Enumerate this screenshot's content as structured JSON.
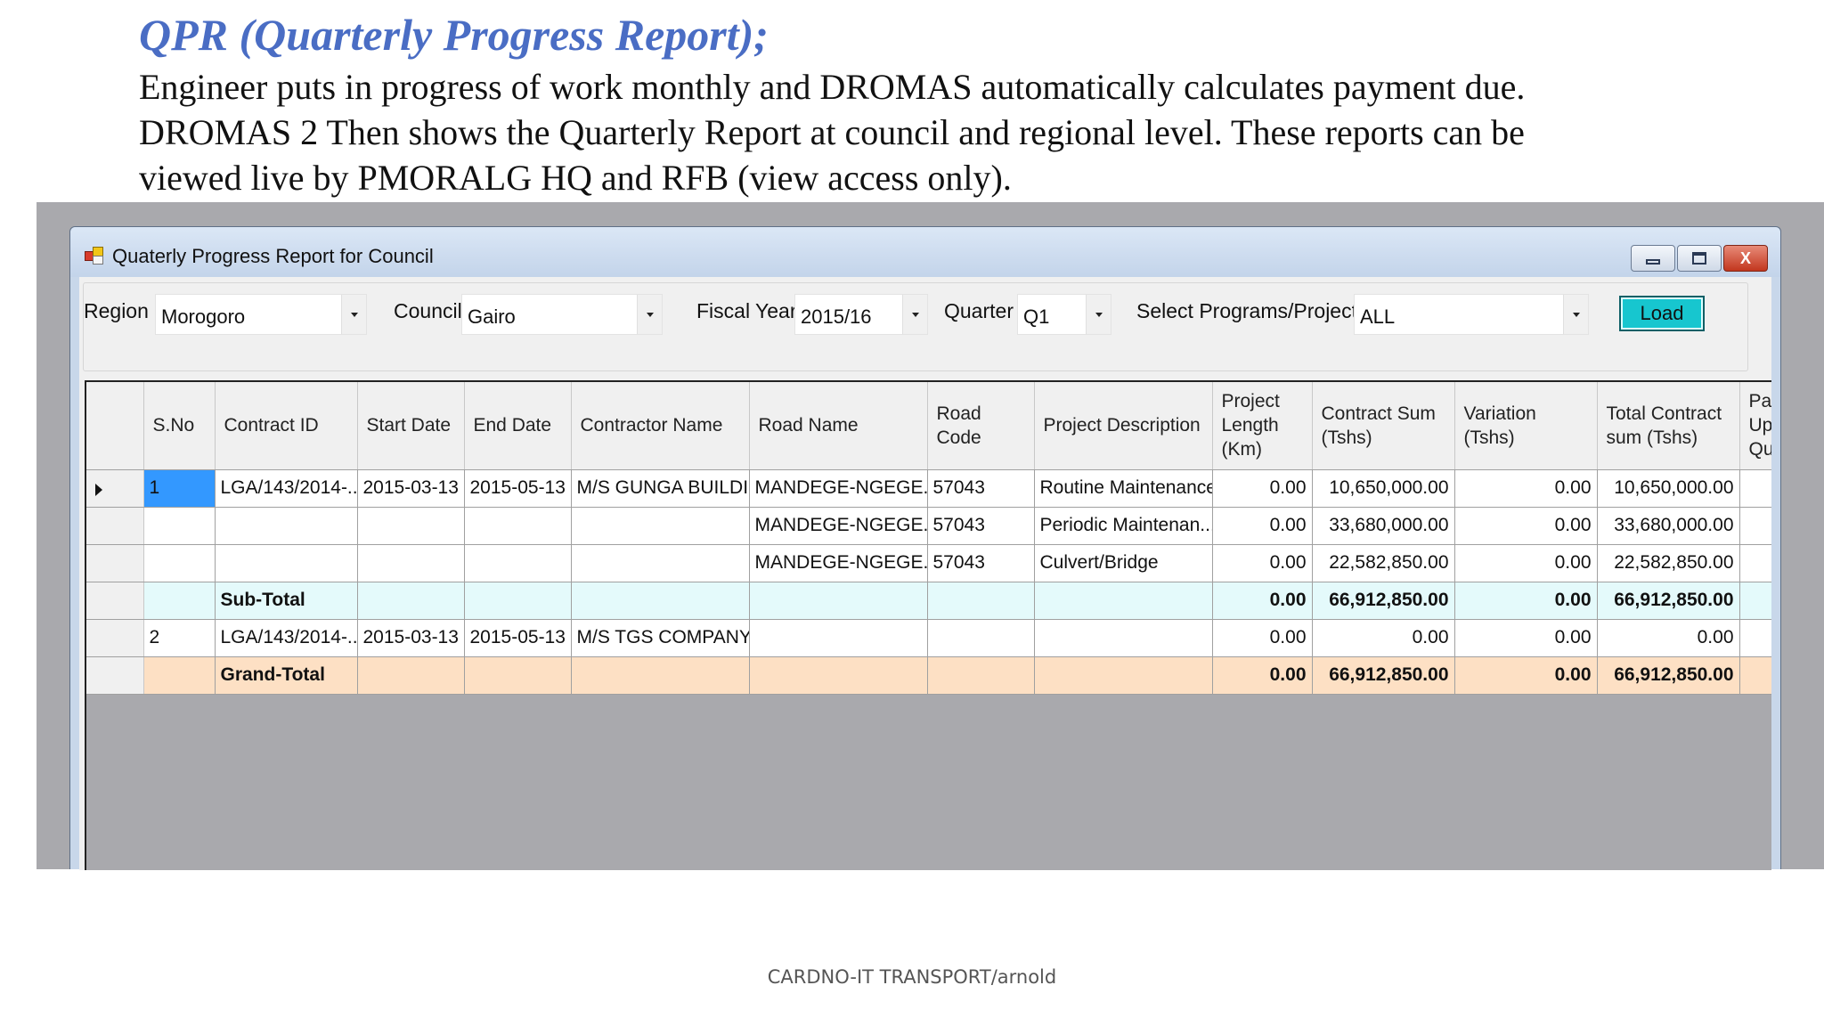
{
  "slide": {
    "title": "QPR (Quarterly Progress Report);",
    "body_lines": [
      "Engineer puts in progress of work monthly and DROMAS automatically calculates payment due.",
      "DROMAS 2 Then shows the Quarterly Report at council and regional level. These reports can be",
      "viewed live by PMORALG HQ and RFB  (view access only)."
    ],
    "footer": "CARDNO-IT TRANSPORT/arnold"
  },
  "window": {
    "title": "Quaterly Progress Report for Council",
    "buttons": {
      "minimize": "minimize",
      "maximize": "maximize",
      "close": "X"
    }
  },
  "filters": {
    "region_label": "Region",
    "region_value": "Morogoro",
    "council_label": "Council",
    "council_value": "Gairo",
    "fiscal_year_label": "Fiscal Year",
    "fiscal_year_value": "2015/16",
    "quarter_label": "Quarter",
    "quarter_value": "Q1",
    "programs_label": "Select Programs/Projects:",
    "programs_value": "ALL",
    "load_label": "Load"
  },
  "grid": {
    "columns": [
      "S.No",
      "Contract ID",
      "Start Date",
      "End Date",
      "Contractor Name",
      "Road Name",
      "Road Code",
      "Project Description",
      "Project Length (Km)",
      "Contract Sum (Tshs)",
      "Variation (Tshs)",
      "Total Contract sum (Tshs)",
      "Pa Up Qu"
    ],
    "rows": [
      {
        "type": "data",
        "current": true,
        "cells": [
          "1",
          "LGA/143/2014-...",
          "2015-03-13",
          "2015-05-13",
          "M/S GUNGA BUILDI...",
          "MANDEGE-NGEGE...",
          "57043",
          "Routine Maintenance",
          "0.00",
          "10,650,000.00",
          "0.00",
          "10,650,000.00",
          ""
        ]
      },
      {
        "type": "data",
        "current": false,
        "cells": [
          "",
          "",
          "",
          "",
          "",
          "MANDEGE-NGEGE...",
          "57043",
          "Periodic Maintenan...",
          "0.00",
          "33,680,000.00",
          "0.00",
          "33,680,000.00",
          ""
        ]
      },
      {
        "type": "data",
        "current": false,
        "cells": [
          "",
          "",
          "",
          "",
          "",
          "MANDEGE-NGEGE...",
          "57043",
          "Culvert/Bridge",
          "0.00",
          "22,582,850.00",
          "0.00",
          "22,582,850.00",
          ""
        ]
      },
      {
        "type": "subtotal",
        "current": false,
        "cells": [
          "",
          "Sub-Total",
          "",
          "",
          "",
          "",
          "",
          "",
          "0.00",
          "66,912,850.00",
          "0.00",
          "66,912,850.00",
          ""
        ]
      },
      {
        "type": "data",
        "current": false,
        "cells": [
          "2",
          "LGA/143/2014-...",
          "2015-03-13",
          "2015-05-13",
          "M/S TGS COMPANY...",
          "",
          "",
          "",
          "0.00",
          "0.00",
          "0.00",
          "0.00",
          ""
        ]
      },
      {
        "type": "grandtotal",
        "current": false,
        "cells": [
          "",
          "Grand-Total",
          "",
          "",
          "",
          "",
          "",
          "",
          "0.00",
          "66,912,850.00",
          "0.00",
          "66,912,850.00",
          ""
        ]
      }
    ]
  },
  "colors": {
    "title_blue": "#4a6dc4",
    "subtotal_bg": "#e4fafb",
    "grandtotal_bg": "#fde0c4",
    "load_button": "#17c6cf",
    "selection": "#3398ff"
  }
}
